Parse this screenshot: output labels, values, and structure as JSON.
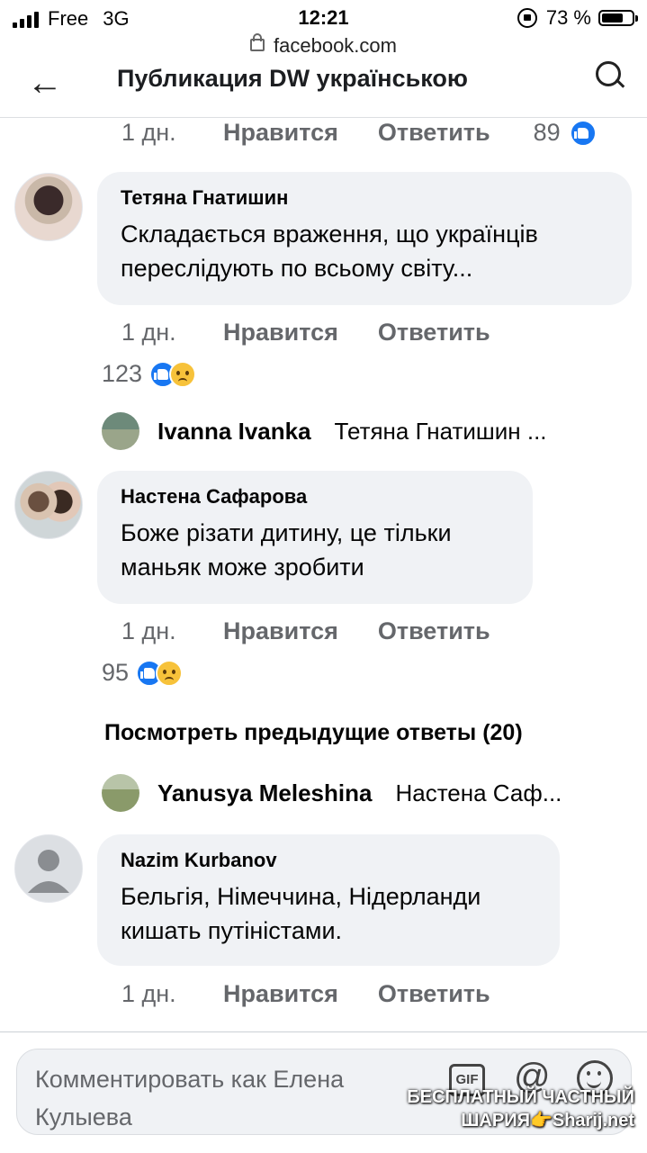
{
  "status_bar": {
    "carrier": "Free",
    "network": "3G",
    "time": "12:21",
    "battery": "73 %",
    "battery_level": 0.73
  },
  "browser": {
    "url": "facebook.com"
  },
  "header": {
    "title": "Публикация DW українською",
    "back_icon": "back-arrow-icon",
    "search_icon": "search-icon"
  },
  "colors": {
    "like_blue": "#1877f2",
    "bubble_bg": "#f0f2f5",
    "meta_gray": "#65676b"
  },
  "labels": {
    "like": "Нравится",
    "reply": "Ответить"
  },
  "top_meta": {
    "time": "1 дн.",
    "count": "89"
  },
  "comments": [
    {
      "author": "Тетяна Гнатишин",
      "text": "Складається враження, що українців переслідують по всьому світу...",
      "time": "1 дн.",
      "reactions": "123",
      "reply": {
        "name": "Ivanna Ivanka",
        "snippet": "Тетяна Гнатишин ..."
      }
    },
    {
      "author": "Настена Сафарова",
      "text": "Боже різати дитину, це тільки маньяк може зробити",
      "time": "1 дн.",
      "reactions": "95",
      "previous_replies": "Посмотреть предыдущие ответы (20)",
      "reply": {
        "name": "Yanusya Meleshina",
        "snippet": "Настена Саф..."
      }
    },
    {
      "author": "Nazim Kurbanov",
      "text": "Бельгія, Німеччина, Нідерланди кишать путіністами.",
      "time": "1 дн."
    }
  ],
  "composer": {
    "placeholder": "Комментировать как Елена Кулыева",
    "gif_label": "GIF",
    "at_symbol": "@"
  },
  "watermark": {
    "line1": "БЕСПЛАТНЫЙ ЧАСТНЫЙ",
    "line2": "ШАРИЯ👉Sharij.net"
  }
}
